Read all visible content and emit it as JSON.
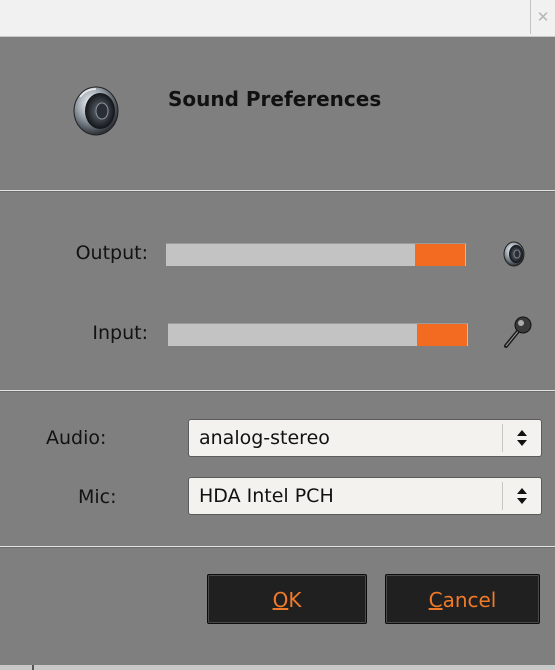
{
  "window": {
    "close_glyph": "✕"
  },
  "header": {
    "title": "Sound Preferences",
    "icon": "speaker-icon"
  },
  "levels": {
    "output": {
      "label": "Output:",
      "level": 0.83,
      "icon": "speaker-icon"
    },
    "input": {
      "label": "Input:",
      "level": 0.83,
      "icon": "microphone-icon"
    }
  },
  "devices": {
    "audio": {
      "label": "Audio:",
      "value": "analog-stereo"
    },
    "mic": {
      "label": "Mic:",
      "value": "HDA Intel PCH"
    }
  },
  "buttons": {
    "ok": {
      "mnemonic": "O",
      "rest": "K"
    },
    "cancel": {
      "mnemonic": "C",
      "rest": "ancel"
    }
  },
  "colors": {
    "meter_fill": "#f26b21",
    "button_text": "#f07a2a",
    "dialog_bg": "#7f7f7f"
  }
}
